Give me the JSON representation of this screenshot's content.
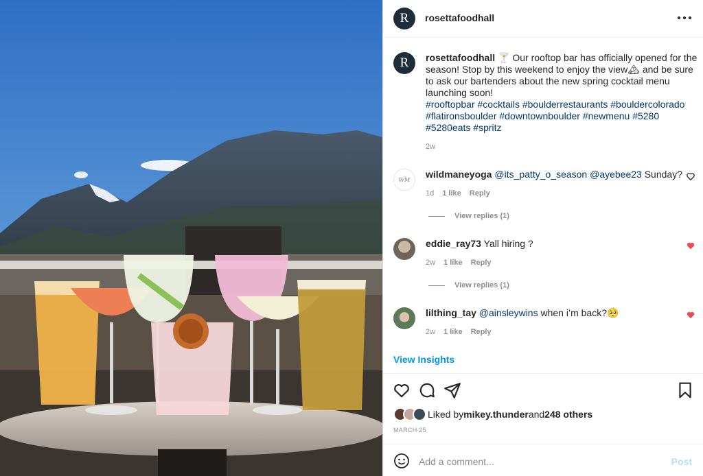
{
  "photo": {
    "alt_subject": "rooftop-cocktails-photo"
  },
  "header": {
    "username": "rosettafoodhall",
    "avatar_letter": "R",
    "more_icon": "more-horizontal-icon"
  },
  "caption": {
    "username": "rosettafoodhall",
    "text_part1": " 🍸 Our rooftop bar has officially opened for the season! Stop by this weekend to enjoy the view",
    "emoji_mountain": "🏔",
    "text_part2": " and be sure to ask our bartenders about the new spring cocktail menu launching soon!",
    "hashtags": "#rooftopbar #cocktails #boulderrestaurants #bouldercolorado #flatironsboulder #downtownboulder #newmenu #5280 #5280eats #spritz",
    "time": "2w"
  },
  "comments": [
    {
      "username": "wildmaneyoga",
      "mentions": "@its_patty_o_season @ayebee23",
      "text": " Sunday?",
      "time": "1d",
      "likes": "1 like",
      "reply": "Reply",
      "view_replies": "View replies (1)",
      "liked": false
    },
    {
      "username": "eddie_ray73",
      "mentions": "",
      "text": "Yall hiring ?",
      "time": "2w",
      "likes": "1 like",
      "reply": "Reply",
      "view_replies": "View replies (1)",
      "liked": true
    },
    {
      "username": "lilthing_tay",
      "mentions": "@ainsleywins",
      "text": " when i’m back?🥺",
      "time": "2w",
      "likes": "1 like",
      "reply": "Reply",
      "liked": true
    }
  ],
  "insights_label": "View Insights",
  "likes": {
    "prefix": "Liked by ",
    "user": "mikey.thunder",
    "middle": " and ",
    "others": "248 others"
  },
  "date": "MARCH 25",
  "comment_box": {
    "placeholder": "Add a comment...",
    "post_label": "Post"
  },
  "colors": {
    "link": "#00376b",
    "heart": "#ed4956",
    "accent": "#0095f6"
  }
}
